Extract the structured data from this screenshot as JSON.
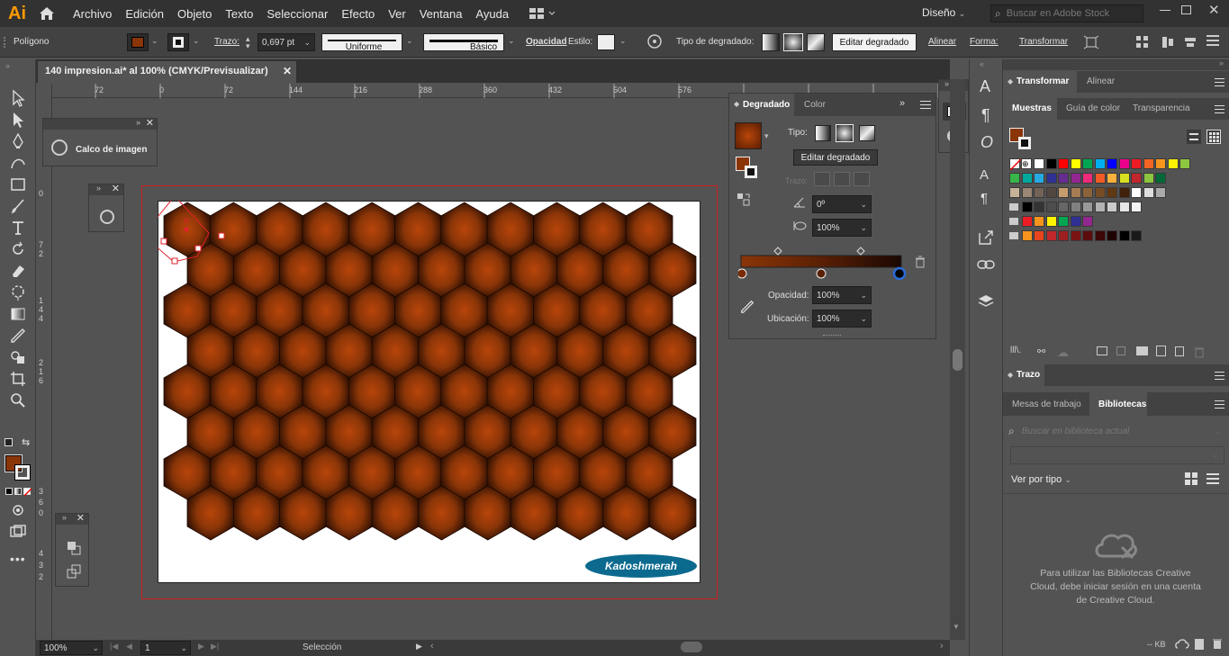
{
  "app": {
    "logo": "Ai"
  },
  "menu": [
    "Archivo",
    "Edición",
    "Objeto",
    "Texto",
    "Seleccionar",
    "Efecto",
    "Ver",
    "Ventana",
    "Ayuda"
  ],
  "workspace": "Diseño",
  "stock_search": {
    "placeholder": "Buscar en Adobe Stock"
  },
  "control_bar": {
    "object_type": "Polígono",
    "stroke_label": "Trazo:",
    "stroke_value": "0,697 pt",
    "profile_label": "Uniforme",
    "brush_label": "Básico",
    "opacity_label": "Opacidad",
    "style_label": "Estilo:",
    "gradient_type_label": "Tipo de degradado:",
    "edit_gradient": "Editar degradado",
    "align": "Alinear",
    "shape": "Forma:",
    "transform": "Transformar"
  },
  "document_tab": {
    "title": "140 impresion.ai* al 100% (CMYK/Previsualizar)"
  },
  "ruler_h": [
    "72",
    "0",
    "72",
    "144",
    "216",
    "288",
    "360",
    "432",
    "504",
    "576"
  ],
  "ruler_v": [
    "0",
    "7",
    "2",
    "1",
    "4",
    "4",
    "2",
    "1",
    "6",
    "3",
    "6",
    "0",
    "4",
    "3",
    "2"
  ],
  "image_trace_panel": {
    "title": "Calco de imagen"
  },
  "gradient_panel": {
    "tabs": [
      "Degradado",
      "Color"
    ],
    "type_label": "Tipo:",
    "edit_button": "Editar degradado",
    "stroke_label": "Trazo:",
    "angle": "0º",
    "aspect": "100%",
    "opacity_label": "Opacidad:",
    "opacity": "100%",
    "location_label": "Ubicación:",
    "location": "100%",
    "stops": [
      "#7a2a05",
      "#5a2005",
      "#000000"
    ]
  },
  "right_panels": {
    "transform_tabs": [
      "Transformar",
      "Alinear"
    ],
    "swatch_tabs": [
      "Muestras",
      "Guía de color",
      "Transparencia"
    ],
    "stroke_panel": "Trazo",
    "library_tabs": [
      "Mesas de trabajo",
      "Bibliotecas"
    ],
    "library_search_placeholder": "Buscar en biblioteca actual",
    "view_by": "Ver por tipo",
    "library_message": "Para utilizar las Bibliotecas Creative Cloud, debe iniciar sesión en una cuenta de Creative Cloud.",
    "kb": "-- KB"
  },
  "swatches": {
    "row1": [
      "#ffffff",
      "#000000",
      "#ff0000",
      "#ffff00",
      "#00a651",
      "#00aeef",
      "#0000ff",
      "#ec008c",
      "#ed1c24",
      "#f26522",
      "#f7941d",
      "#fff200",
      "#8dc63f"
    ],
    "row2": [
      "#39b54a",
      "#00a99d",
      "#27aae1",
      "#2e3192",
      "#662d91",
      "#92278f",
      "#ee2a7b",
      "#f15a24",
      "#fbb03b",
      "#d9e021",
      "#c1272d",
      "#8cc63f",
      "#006837"
    ],
    "row3": [
      "#c7b299",
      "#998675",
      "#736357",
      "#534741",
      "#c69c6d",
      "#a67c52",
      "#8c6239",
      "#754c24",
      "#603913",
      "#42210b",
      "#ffffff",
      "#dddddd",
      "#aaaaaa"
    ],
    "row4": [
      "#000000",
      "#333333",
      "#4d4d4d",
      "#666666",
      "#808080",
      "#999999",
      "#b3b3b3",
      "#cccccc",
      "#e6e6e6",
      "#f2f2f2"
    ],
    "row5": [
      "#ed1c24",
      "#f7941d",
      "#fff200",
      "#00a651",
      "#2e3192",
      "#92278f"
    ],
    "row6": [
      "#f7941d",
      "#e8451e",
      "#c1272d",
      "#9e1f1f",
      "#7a1414",
      "#5c0d0d",
      "#3d0707",
      "#1f0303",
      "#000000",
      "#1a1a1a"
    ]
  },
  "status": {
    "zoom": "100%",
    "artboard": "1",
    "tool": "Selección"
  },
  "watermark": "Kadoshmerah",
  "colors": {
    "hex_dark": "#2a0e02",
    "hex_mid": "#8a3508",
    "hex_light": "#b8450a",
    "accent": "#ff9a00"
  }
}
